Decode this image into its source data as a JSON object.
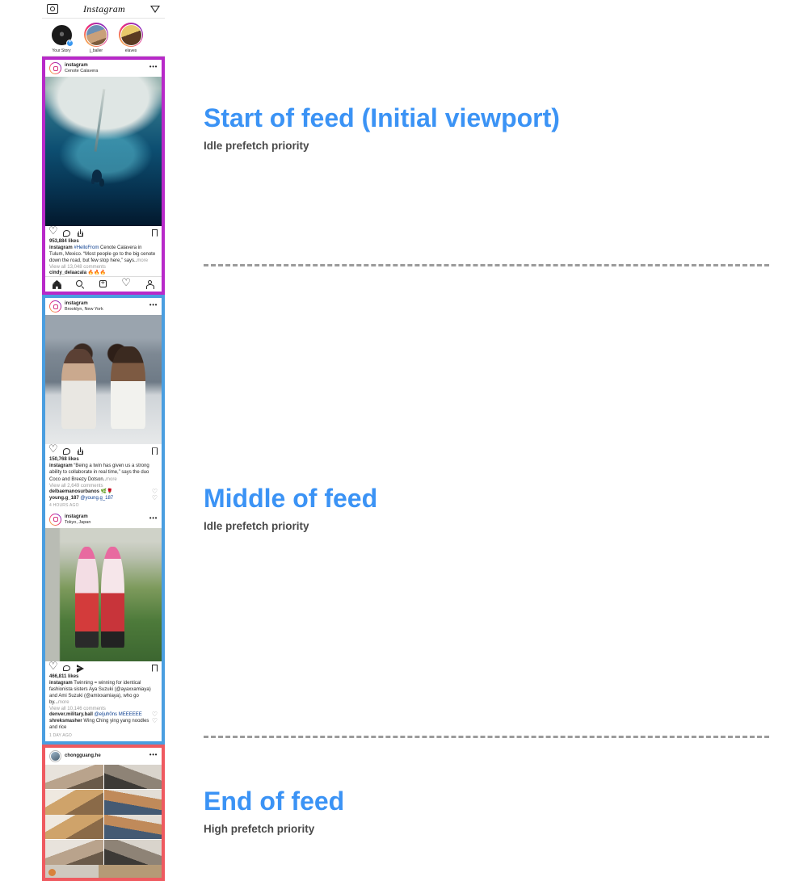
{
  "annotations": [
    {
      "title": "Start of feed (Initial viewport)",
      "subtitle": "Idle prefetch priority"
    },
    {
      "title": "Middle of feed",
      "subtitle": "Idle prefetch priority"
    },
    {
      "title": "End of feed",
      "subtitle": "High prefetch priority"
    }
  ],
  "phone": {
    "app_logo": "Instagram",
    "icons": {
      "camera": "camera-icon",
      "igtv": "igtv-icon"
    },
    "stories": [
      {
        "name": "Your Story",
        "has_add_badge": true,
        "ring": "none"
      },
      {
        "name": "j_baller",
        "has_add_badge": false,
        "ring": "gradient"
      },
      {
        "name": "elaves",
        "has_add_badge": false,
        "ring": "gradient"
      }
    ],
    "tabbar": [
      "home-icon",
      "search-icon",
      "add-post-icon",
      "activity-heart-icon",
      "profile-icon"
    ]
  },
  "posts": [
    {
      "username": "instagram",
      "location": "Cenote Calavera",
      "menu": "•••",
      "likes": "953,884 likes",
      "caption_user": "instagram",
      "caption_tag": "#HelloFrom",
      "caption_text": " Cenote Calavera in Tulum, Mexico. “Most people go to the big cenote down the road, but few stop here,” says..",
      "caption_more": "more",
      "comments_link": "View all 13,048 comments",
      "comment_user": "cindy_delaacala",
      "comment_text": "🔥🔥🔥",
      "border_color": "#b829c9"
    },
    {
      "username": "instagram",
      "location": "Brooklyn, New York",
      "menu": "•••",
      "likes": "150,768 likes",
      "caption_user": "instagram",
      "caption_text": " “Being a twin has given us a strong ability to collaborate in real time,” says the duo Coco and Breezy Dotson..",
      "caption_more": "more",
      "comments_link": "View all 2,649 comments",
      "comments": [
        {
          "user": "delbaemanosurbanos",
          "text": " 🌿🌹"
        },
        {
          "user": "young.g_187",
          "text": " @young.g_187"
        }
      ],
      "timestamp": "4 HOURS AGO",
      "border_color": "#4a9ee0"
    },
    {
      "username": "instagram",
      "location": "Tokyo, Japan",
      "menu": "•••",
      "likes": "466,811 likes",
      "caption_user": "instagram",
      "caption_text": " Twinning = winning for identical fashionista sisters Aya Suzuki (@ayaxxamiaya) and Ami Suzuki (@amixxamiaya), who go by...",
      "caption_more": "more",
      "comments_link": "View all 10,146 comments",
      "comments": [
        {
          "user": "denver.military.ball",
          "text": " @eljuh0ns MEEEEEE"
        },
        {
          "user": "shreksmasher",
          "text": " Wing Ching ying yang noodles and rice"
        }
      ],
      "timestamp": "1 DAY AGO",
      "border_color": "#4a9ee0"
    },
    {
      "username": "chongguang.he",
      "menu": "•••",
      "border_color": "#ef5a60"
    }
  ]
}
